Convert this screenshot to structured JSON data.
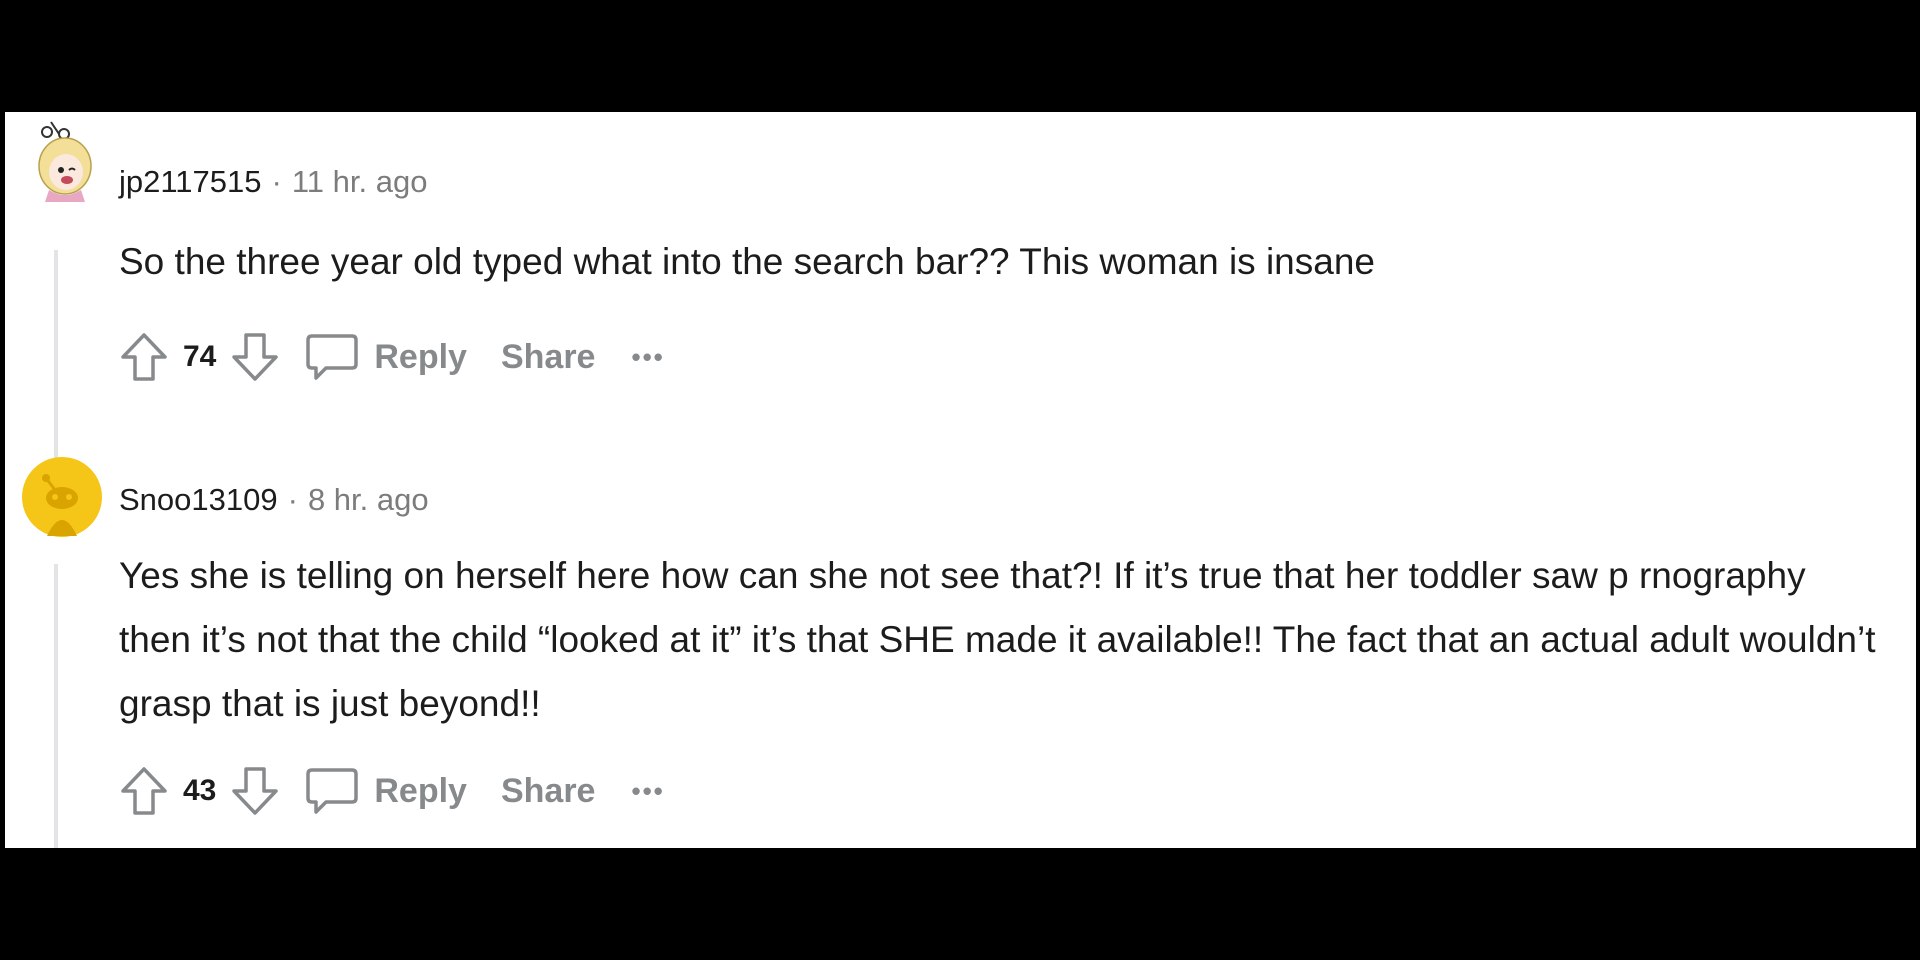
{
  "comments": [
    {
      "username": "jp2117515",
      "separator": "·",
      "time": "11 hr. ago",
      "body": "So the three year old typed what into the search bar?? This woman is insane",
      "score": "74",
      "reply_label": "Reply",
      "share_label": "Share",
      "more_label": "•••",
      "avatar_icon": "snoo-avatar-blonde-icon"
    },
    {
      "username": "Snoo13109",
      "separator": "·",
      "time": "8 hr. ago",
      "body": "Yes she is telling on herself here how can she not see that?! If it’s true that her toddler saw p  rnography then it’s not that the child “looked at it” it’s that SHE made it available!! The fact that an actual adult wouldn’t grasp that is just beyond!!",
      "score": "43",
      "reply_label": "Reply",
      "share_label": "Share",
      "more_label": "•••",
      "avatar_icon": "snoo-avatar-default-icon"
    }
  ],
  "colors": {
    "background": "#000000",
    "panel": "#ffffff",
    "text": "#1c1c1c",
    "muted": "#878a8c",
    "avatar_yellow": "#f5c518"
  }
}
